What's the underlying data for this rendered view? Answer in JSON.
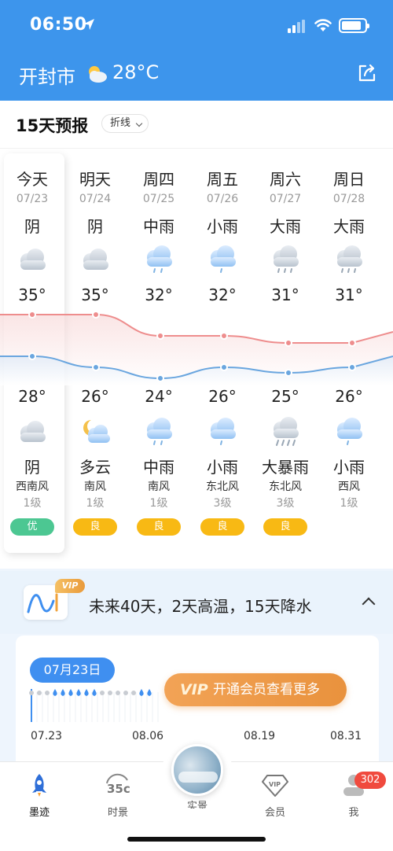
{
  "status_bar": {
    "time": "06:50"
  },
  "header": {
    "city": "开封市",
    "temp": "28°C"
  },
  "forecast": {
    "title": "15天预报",
    "mode": "折线",
    "days": [
      {
        "day": "今天",
        "date": "07/23",
        "day_cond": "阴",
        "high": "35°",
        "low": "28°",
        "night_cond": "阴",
        "wind": "西南风",
        "level": "1级",
        "aqi": "优"
      },
      {
        "day": "明天",
        "date": "07/24",
        "day_cond": "阴",
        "high": "35°",
        "low": "26°",
        "night_cond": "多云",
        "wind": "南风",
        "level": "1级",
        "aqi": "良"
      },
      {
        "day": "周四",
        "date": "07/25",
        "day_cond": "中雨",
        "high": "32°",
        "low": "24°",
        "night_cond": "中雨",
        "wind": "南风",
        "level": "1级",
        "aqi": "良"
      },
      {
        "day": "周五",
        "date": "07/26",
        "day_cond": "小雨",
        "high": "32°",
        "low": "26°",
        "night_cond": "小雨",
        "wind": "东北风",
        "level": "3级",
        "aqi": "良"
      },
      {
        "day": "周六",
        "date": "07/27",
        "day_cond": "大雨",
        "high": "31°",
        "low": "25°",
        "night_cond": "大暴雨",
        "wind": "东北风",
        "level": "3级",
        "aqi": "良"
      },
      {
        "day": "周日",
        "date": "07/28",
        "day_cond": "大雨",
        "high": "31°",
        "low": "26°",
        "night_cond": "小雨",
        "wind": "西风",
        "level": "1级",
        "aqi": ""
      }
    ],
    "high_values": [
      35,
      35,
      32,
      32,
      31,
      31
    ],
    "low_values": [
      28,
      26,
      24,
      26,
      25,
      26
    ],
    "colors": {
      "high_line": "#f2a5a5",
      "low_line": "#7fb3e3",
      "aqi_good": "#4cc792",
      "aqi_fair": "#f8b914"
    }
  },
  "long_range": {
    "vip_badge": "VIP",
    "summary": "未来40天，2天高温，15天降水",
    "selected_date": "07月23日",
    "cta": "开通会员查看更多",
    "cta_logo": "VIP",
    "axis": [
      "07.23",
      "08.06",
      "08.19",
      "08.31"
    ]
  },
  "tabbar": {
    "tabs": [
      {
        "label": "墨迹",
        "icon": "rocket-icon"
      },
      {
        "label": "时景",
        "icon": "35c-icon"
      },
      {
        "label": "实景",
        "icon": "live-photo-icon"
      },
      {
        "label": "会员",
        "icon": "vip-diamond-icon"
      },
      {
        "label": "我",
        "icon": "profile-icon"
      }
    ],
    "badge": "302"
  }
}
